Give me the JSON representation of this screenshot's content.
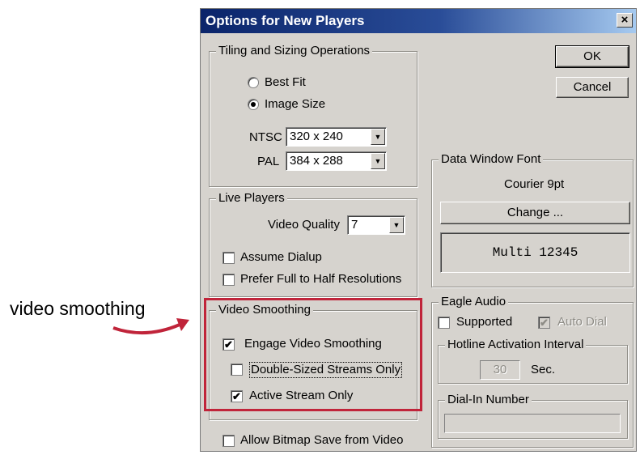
{
  "annotation": {
    "label": "video smoothing",
    "arrow_color": "#c0243a"
  },
  "dialog": {
    "title": "Options for New Players",
    "close_glyph": "×",
    "ok_label": "OK",
    "cancel_label": "Cancel"
  },
  "tiling": {
    "legend": "Tiling and Sizing Operations",
    "best_fit": {
      "label": "Best Fit",
      "selected": false
    },
    "image_size": {
      "label": "Image Size",
      "selected": true
    },
    "ntsc_label": "NTSC",
    "ntsc_value": "320 x 240",
    "pal_label": "PAL",
    "pal_value": "384 x 288"
  },
  "live_players": {
    "legend": "Live Players",
    "video_quality_label": "Video Quality",
    "video_quality_value": "7",
    "assume_dialup": {
      "label": "Assume Dialup",
      "checked": false
    },
    "prefer_full": {
      "label": "Prefer Full to Half Resolutions",
      "checked": false
    }
  },
  "video_smoothing": {
    "legend": "Video Smoothing",
    "engage": {
      "label": "Engage Video Smoothing",
      "checked": true
    },
    "double_sized": {
      "label": "Double-Sized Streams Only",
      "checked": false
    },
    "active_stream": {
      "label": "Active Stream Only",
      "checked": true
    },
    "highlight_color": "#c0243a"
  },
  "allow_bitmap": {
    "label": "Allow Bitmap Save from Video",
    "checked": false
  },
  "data_window_font": {
    "legend": "Data Window Font",
    "font_name": "Courier 9pt",
    "change_label": "Change ...",
    "preview_text": "Multi 12345"
  },
  "eagle_audio": {
    "legend": "Eagle Audio",
    "supported": {
      "label": "Supported",
      "checked": false
    },
    "auto_dial": {
      "label": "Auto Dial",
      "checked": true,
      "disabled": true
    },
    "hotline": {
      "legend": "Hotline Activation Interval",
      "value": "30",
      "unit": "Sec."
    },
    "dial_in": {
      "legend": "Dial-In Number",
      "value": ""
    }
  },
  "colors": {
    "titlebar": "#0a246a",
    "face": "#d6d3ce"
  },
  "icons": {
    "checkmark": "✔",
    "dropdown": "▼"
  }
}
